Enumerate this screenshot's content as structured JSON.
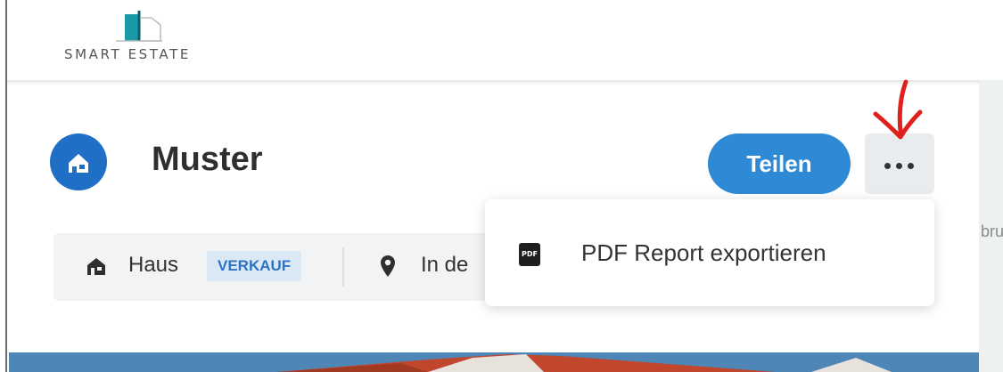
{
  "brand": {
    "name": "SMART ESTATE"
  },
  "property": {
    "title": "Muster",
    "type": "Haus",
    "status_badge": "VERKAUF",
    "location": "In de"
  },
  "actions": {
    "share_label": "Teilen",
    "more_icon": "ellipsis-icon"
  },
  "dropdown": {
    "items": [
      {
        "icon": "pdf-icon",
        "icon_text": "PDF",
        "label": "PDF Report exportieren"
      }
    ]
  },
  "map_fragment": {
    "text": "bru"
  },
  "colors": {
    "primary": "#2f8ad6",
    "badge_circle": "#1f6fc6",
    "badge_bg": "#dbe8f6",
    "annotation_arrow": "#e0201c"
  }
}
